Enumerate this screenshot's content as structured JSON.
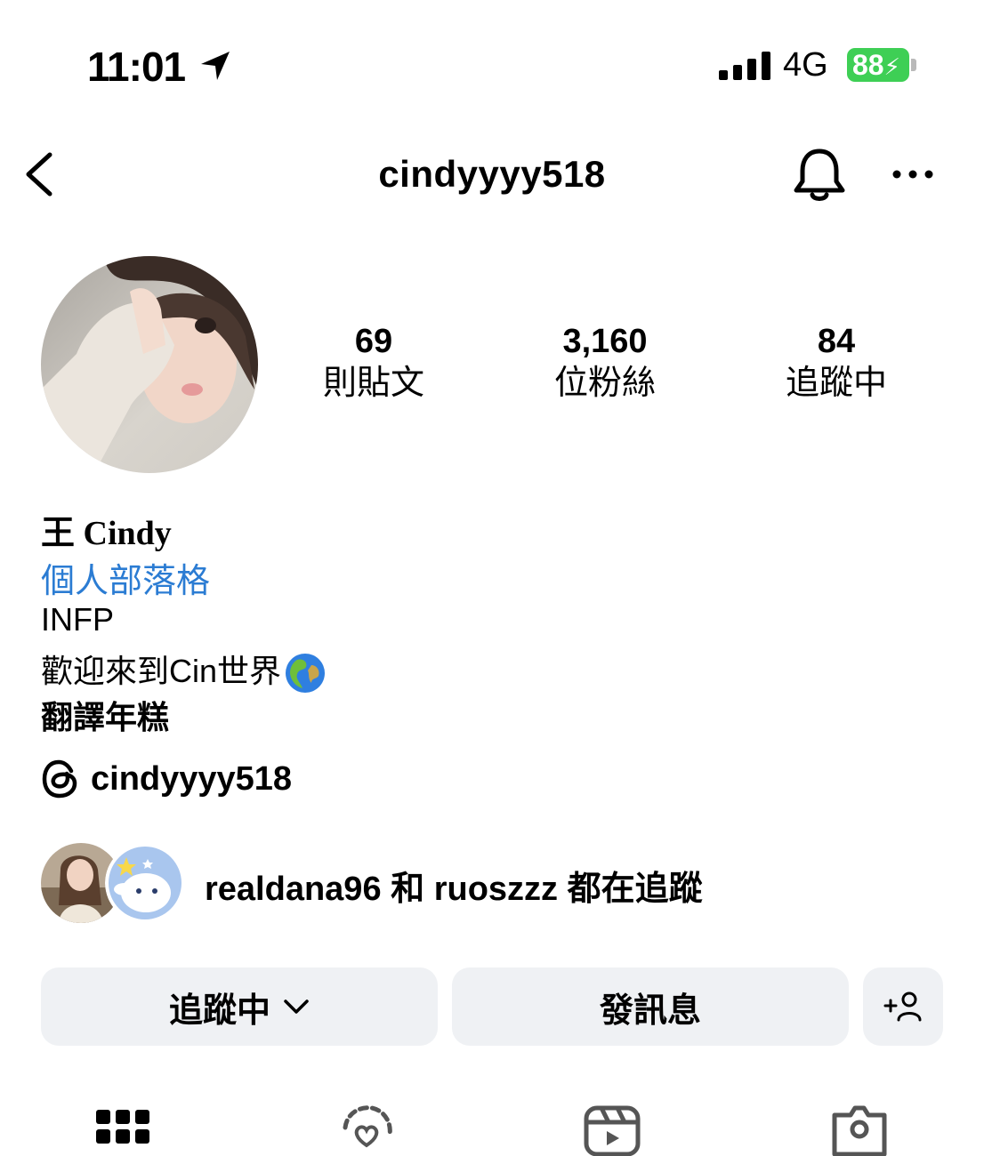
{
  "status_bar": {
    "time": "11:01",
    "network": "4G",
    "battery": "88"
  },
  "nav": {
    "title": "cindyyyy518"
  },
  "stats": [
    {
      "value": "69",
      "label": "則貼文"
    },
    {
      "value": "3,160",
      "label": "位粉絲"
    },
    {
      "value": "84",
      "label": "追蹤中"
    }
  ],
  "bio": {
    "name": "王 Cindy",
    "link": "個人部落格",
    "line1": "INFP",
    "line2": "歡迎來到Cin世界",
    "line3": "翻譯年糕"
  },
  "threads": {
    "handle": "cindyyyy518"
  },
  "mutual": {
    "text": "realdana96 和 ruoszzz 都在追蹤"
  },
  "buttons": {
    "following": "追蹤中",
    "message": "發訊息"
  },
  "tabs": [
    "grid-icon",
    "tagged-reels-icon",
    "reels-icon",
    "tagged-photos-icon"
  ],
  "colors": {
    "link_blue": "#2b7cd3",
    "battery_green": "#3ecf55",
    "button_bg": "#eff1f4"
  }
}
